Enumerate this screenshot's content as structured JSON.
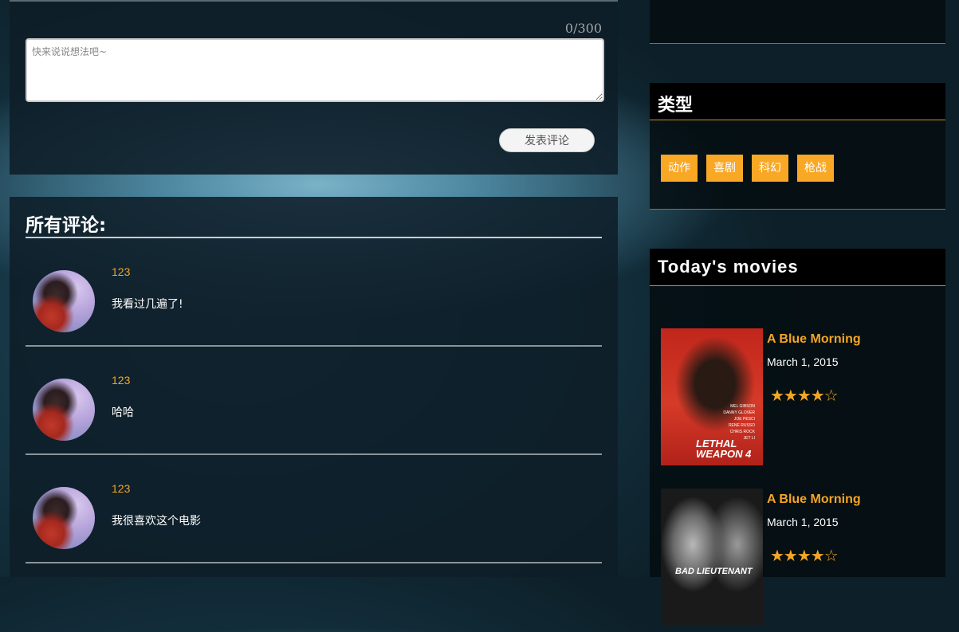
{
  "comment_form": {
    "counter": "0/300",
    "placeholder": "快来说说想法吧~",
    "submit_label": "发表评论"
  },
  "comments": {
    "title": "所有评论:",
    "items": [
      {
        "user": "123",
        "text": "我看过几遍了!"
      },
      {
        "user": "123",
        "text": "哈哈"
      },
      {
        "user": "123",
        "text": "我很喜欢这个电影"
      }
    ]
  },
  "sidebar": {
    "genres_title": "类型",
    "genres": [
      "动作",
      "喜剧",
      "科幻",
      "枪战"
    ],
    "movies_title": "Today's movies",
    "movies": [
      {
        "title": "A Blue Morning",
        "date": "March 1, 2015",
        "stars": "★★★★☆",
        "rating": 4,
        "poster_title": "LETHAL WEAPON 4",
        "poster_credits": "MEL GIBSON\nDANNY GLOVER\nJOE PESCI\nRENE RUSSO\nCHRIS ROCK\nJET LI"
      },
      {
        "title": "A Blue Morning",
        "date": "March 1, 2015",
        "stars": "★★★★☆",
        "rating": 4,
        "poster_title": "BAD LIEUTENANT",
        "poster_credits": ""
      }
    ]
  },
  "colors": {
    "accent": "#f5a623",
    "genre_tag_bg": "#f9a825",
    "header_bg": "#000000"
  }
}
